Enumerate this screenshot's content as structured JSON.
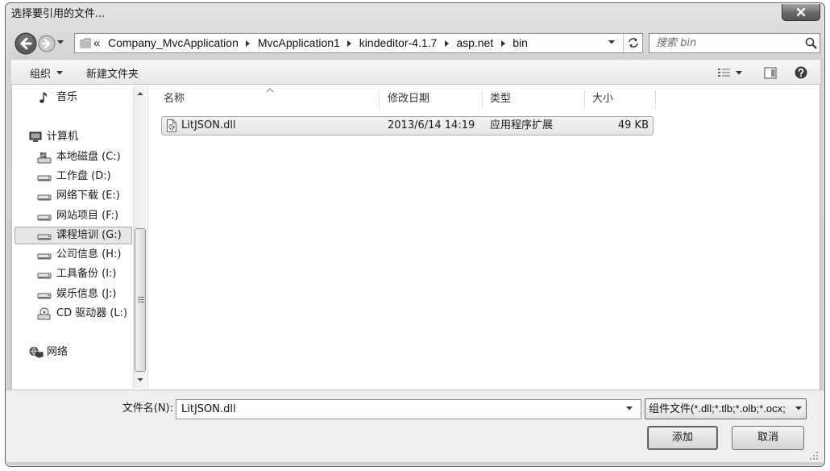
{
  "window": {
    "title": "选择要引用的文件..."
  },
  "address": {
    "overflow": "«",
    "crumbs": [
      "Company_MvcApplication",
      "MvcApplication1",
      "kindeditor-4.1.7",
      "asp.net",
      "bin"
    ],
    "search_placeholder": "搜索 bin"
  },
  "toolbar": {
    "organize": "组织",
    "new_folder": "新建文件夹"
  },
  "nav": {
    "items": [
      {
        "label": "音乐",
        "icon": "music-icon"
      },
      {
        "label": "计算机",
        "icon": "computer-icon"
      },
      {
        "label": "本地磁盘 (C:)",
        "icon": "system-drive-icon"
      },
      {
        "label": "工作盘 (D:)",
        "icon": "drive-icon"
      },
      {
        "label": "网络下载 (E:)",
        "icon": "drive-icon"
      },
      {
        "label": "网站项目 (F:)",
        "icon": "drive-icon"
      },
      {
        "label": "课程培训 (G:)",
        "icon": "drive-icon",
        "selected": true
      },
      {
        "label": "公司信息 (H:)",
        "icon": "drive-icon"
      },
      {
        "label": "工具备份 (I:)",
        "icon": "drive-icon"
      },
      {
        "label": "娱乐信息 (J:)",
        "icon": "drive-icon"
      },
      {
        "label": "CD 驱动器 (L:)",
        "icon": "cd-drive-icon"
      },
      {
        "label": "网络",
        "icon": "network-icon"
      }
    ]
  },
  "files": {
    "columns": [
      "名称",
      "修改日期",
      "类型",
      "大小"
    ],
    "rows": [
      {
        "name": "LitJSON.dll",
        "modified": "2013/6/14 14:19",
        "type": "应用程序扩展",
        "size": "49 KB",
        "icon": "dll-file-icon",
        "selected": true
      }
    ]
  },
  "footer": {
    "filename_label": "文件名(N):",
    "filename_value": "LitJSON.dll",
    "filter": "组件文件(*.dll;*.tlb;*.olb;*.ocx;",
    "add_button": "添加",
    "cancel_button": "取消"
  },
  "colors": {
    "selection_bg": "#e6e6e6",
    "selection_border": "#a9a9a9"
  }
}
